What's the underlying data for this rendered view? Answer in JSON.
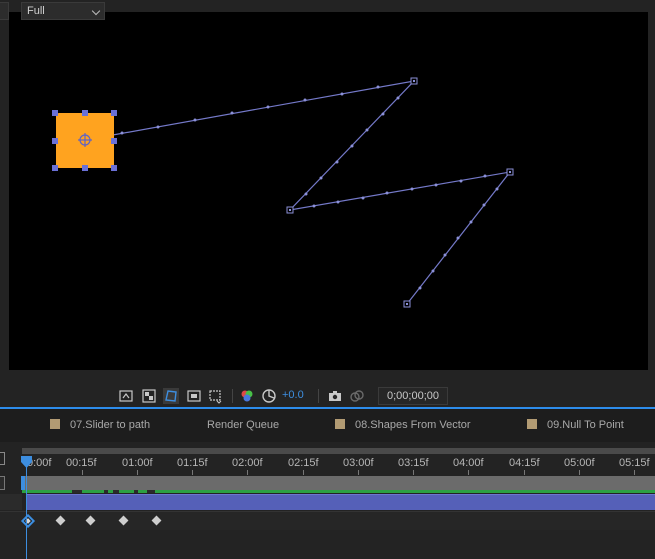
{
  "viewer": {
    "resolution": "Full",
    "exposure": "+0.0",
    "timecode": "0;00;00;00"
  },
  "tabs": [
    {
      "label": "07.Slider to path",
      "has_swatch": true
    },
    {
      "label": "Render Queue",
      "has_swatch": false
    },
    {
      "label": "08.Shapes From Vector",
      "has_swatch": true
    },
    {
      "label": "09.Null To Point",
      "has_swatch": true
    }
  ],
  "ruler": {
    "labels": [
      "0:00f",
      "00:15f",
      "01:00f",
      "01:15f",
      "02:00f",
      "02:15f",
      "03:00f",
      "03:15f",
      "04:00f",
      "04:15f",
      "05:00f",
      "05:15f"
    ]
  },
  "keyframes_count": 5,
  "colors": {
    "accent": "#2d8ceb",
    "layer_bar": "#5560b8",
    "shape_fill": "#ffa31f",
    "motion_path": "#7479c9"
  },
  "icons": {
    "toolbar": [
      "snapshot-region-icon",
      "transparency-grid-icon",
      "mask-visibility-icon",
      "safe-zones-icon",
      "region-of-interest-icon",
      "channel-color-icon",
      "reset-exposure-icon",
      "camera-snapshot-icon",
      "show-snapshot-icon"
    ]
  }
}
